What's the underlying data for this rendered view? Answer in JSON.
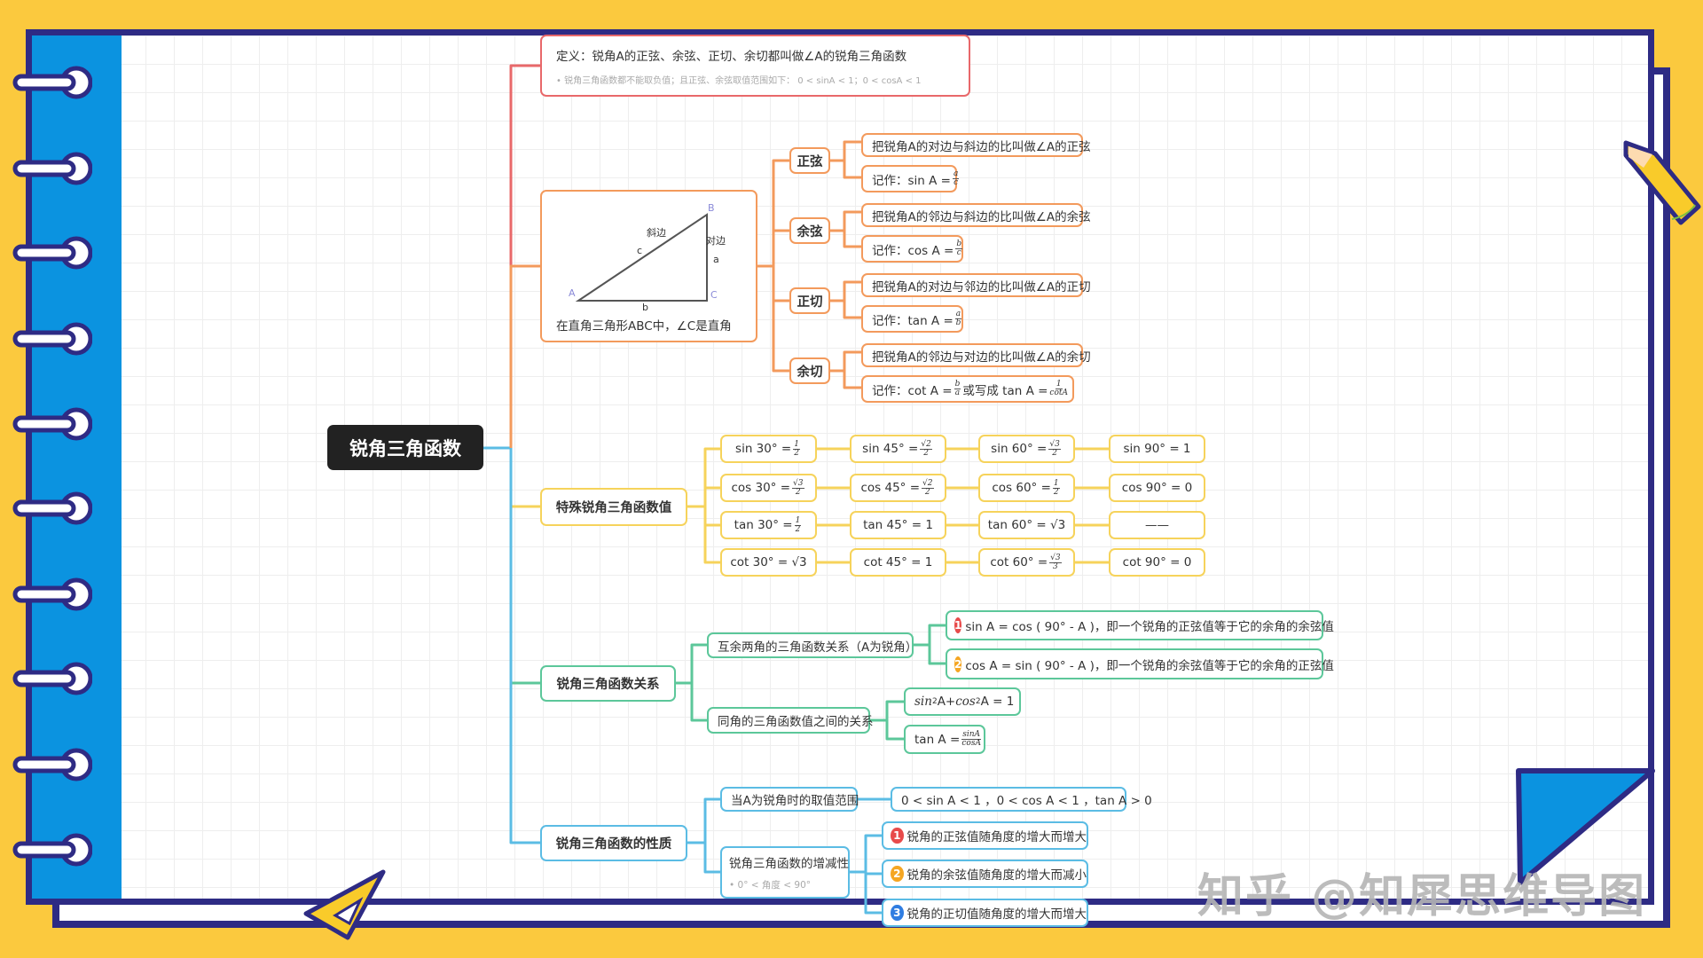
{
  "colors": {
    "background": "#FBC93E",
    "frame": "#2E2B84",
    "spine": "#0B93E0",
    "red": "#E8686A",
    "orange": "#F39A5C",
    "yellow": "#F6D35B",
    "green": "#5CC79A",
    "blue": "#5BBCE4",
    "root": "#222222"
  },
  "watermark": "知乎 @知犀思维导图",
  "root": "锐角三角函数",
  "definition": {
    "title": "定义：锐角A的正弦、余弦、正切、余切都叫做∠A的锐角三角函数",
    "note": "锐角三角函数都不能取负值；且正弦、余弦取值范围如下： 0 < sinA < 1；0 < cosA < 1"
  },
  "triangle": {
    "caption": "在直角三角形ABC中，∠C是直角",
    "labels": {
      "A": "A",
      "B": "B",
      "C": "C",
      "a": "a",
      "b": "b",
      "c": "c",
      "hyp": "斜边",
      "opp": "对边"
    },
    "groups": [
      {
        "label": "正弦",
        "desc": "把锐角A的对边与斜边的比叫做∠A的正弦",
        "formula": [
          {
            "t": "记作：sin A = "
          },
          {
            "n": "a",
            "d": "c"
          }
        ]
      },
      {
        "label": "余弦",
        "desc": "把锐角A的邻边与斜边的比叫做∠A的余弦",
        "formula": [
          {
            "t": "记作：cos A = "
          },
          {
            "n": "b",
            "d": "c"
          }
        ]
      },
      {
        "label": "正切",
        "desc": "把锐角A的对边与邻边的比叫做∠A的正切",
        "formula": [
          {
            "t": "记作：tan A = "
          },
          {
            "n": "a",
            "d": "b"
          }
        ]
      },
      {
        "label": "余切",
        "desc": "把锐角A的邻边与对边的比叫做∠A的余切",
        "formula": [
          {
            "t": "记作：cot A = "
          },
          {
            "n": "b",
            "d": "a"
          },
          {
            "t": "  或写成 tan A = "
          },
          {
            "n": "1",
            "d": "cotA"
          }
        ]
      }
    ]
  },
  "special": {
    "label": "特殊锐角三角函数值",
    "rows": [
      [
        [
          {
            "t": "sin 30° = "
          },
          {
            "n": "1",
            "d": "2"
          }
        ],
        [
          {
            "t": "sin 45° = "
          },
          {
            "n": "√2",
            "d": "2"
          }
        ],
        [
          {
            "t": "sin 60° = "
          },
          {
            "n": "√3",
            "d": "2"
          }
        ],
        [
          {
            "t": "sin 90° = 1"
          }
        ]
      ],
      [
        [
          {
            "t": "cos 30° = "
          },
          {
            "n": "√3",
            "d": "2"
          }
        ],
        [
          {
            "t": "cos 45° = "
          },
          {
            "n": "√2",
            "d": "2"
          }
        ],
        [
          {
            "t": "cos 60° = "
          },
          {
            "n": "1",
            "d": "2"
          }
        ],
        [
          {
            "t": "cos 90° = 0"
          }
        ]
      ],
      [
        [
          {
            "t": "tan 30° = "
          },
          {
            "n": "1",
            "d": "2"
          }
        ],
        [
          {
            "t": "tan 45° = 1"
          }
        ],
        [
          {
            "t": "tan 60° = √3"
          }
        ],
        [
          {
            "t": "——"
          }
        ]
      ],
      [
        [
          {
            "t": "cot 30° = √3"
          }
        ],
        [
          {
            "t": "cot 45° = 1"
          }
        ],
        [
          {
            "t": "cot 60° = "
          },
          {
            "n": "√3",
            "d": "3"
          }
        ],
        [
          {
            "t": "cot 90° = 0"
          }
        ]
      ]
    ]
  },
  "relations": {
    "label": "锐角三角函数关系",
    "complement": {
      "label": "互余两角的三角函数关系（A为锐角）",
      "items": [
        {
          "badge": "1",
          "text": "sin A = cos ( 90° - A )，即一个锐角的正弦值等于它的余角的余弦值"
        },
        {
          "badge": "2",
          "text": "cos A = sin ( 90° - A )，即一个锐角的余弦值等于它的余角的正弦值"
        }
      ]
    },
    "same": {
      "label": "同角的三角函数值之间的关系",
      "items": [
        [
          {
            "i": "sin"
          },
          {
            "sup": "2"
          },
          {
            "t": "A+ "
          },
          {
            "i": "cos"
          },
          {
            "sup": "2"
          },
          {
            "t": " A = 1"
          }
        ],
        [
          {
            "t": "tan A = "
          },
          {
            "n": "sinA",
            "d": "cosA"
          }
        ]
      ]
    }
  },
  "properties": {
    "label": "锐角三角函数的性质",
    "range": {
      "label": "当A为锐角时的取值范围",
      "value": "0 < sin A < 1 ，0 < cos A < 1 ，tan A > 0"
    },
    "monotonic": {
      "label": "锐角三角函数的增减性",
      "note": "0° < 角度 < 90°",
      "items": [
        {
          "badge": "1",
          "text": "锐角的正弦值随角度的增大而增大"
        },
        {
          "badge": "2",
          "text": "锐角的余弦值随角度的增大而减小"
        },
        {
          "badge": "3",
          "text": "锐角的正切值随角度的增大而增大"
        }
      ]
    }
  },
  "badge_colors": {
    "1": "#E84B4B",
    "2": "#F5A623",
    "3": "#2F7DE1"
  }
}
